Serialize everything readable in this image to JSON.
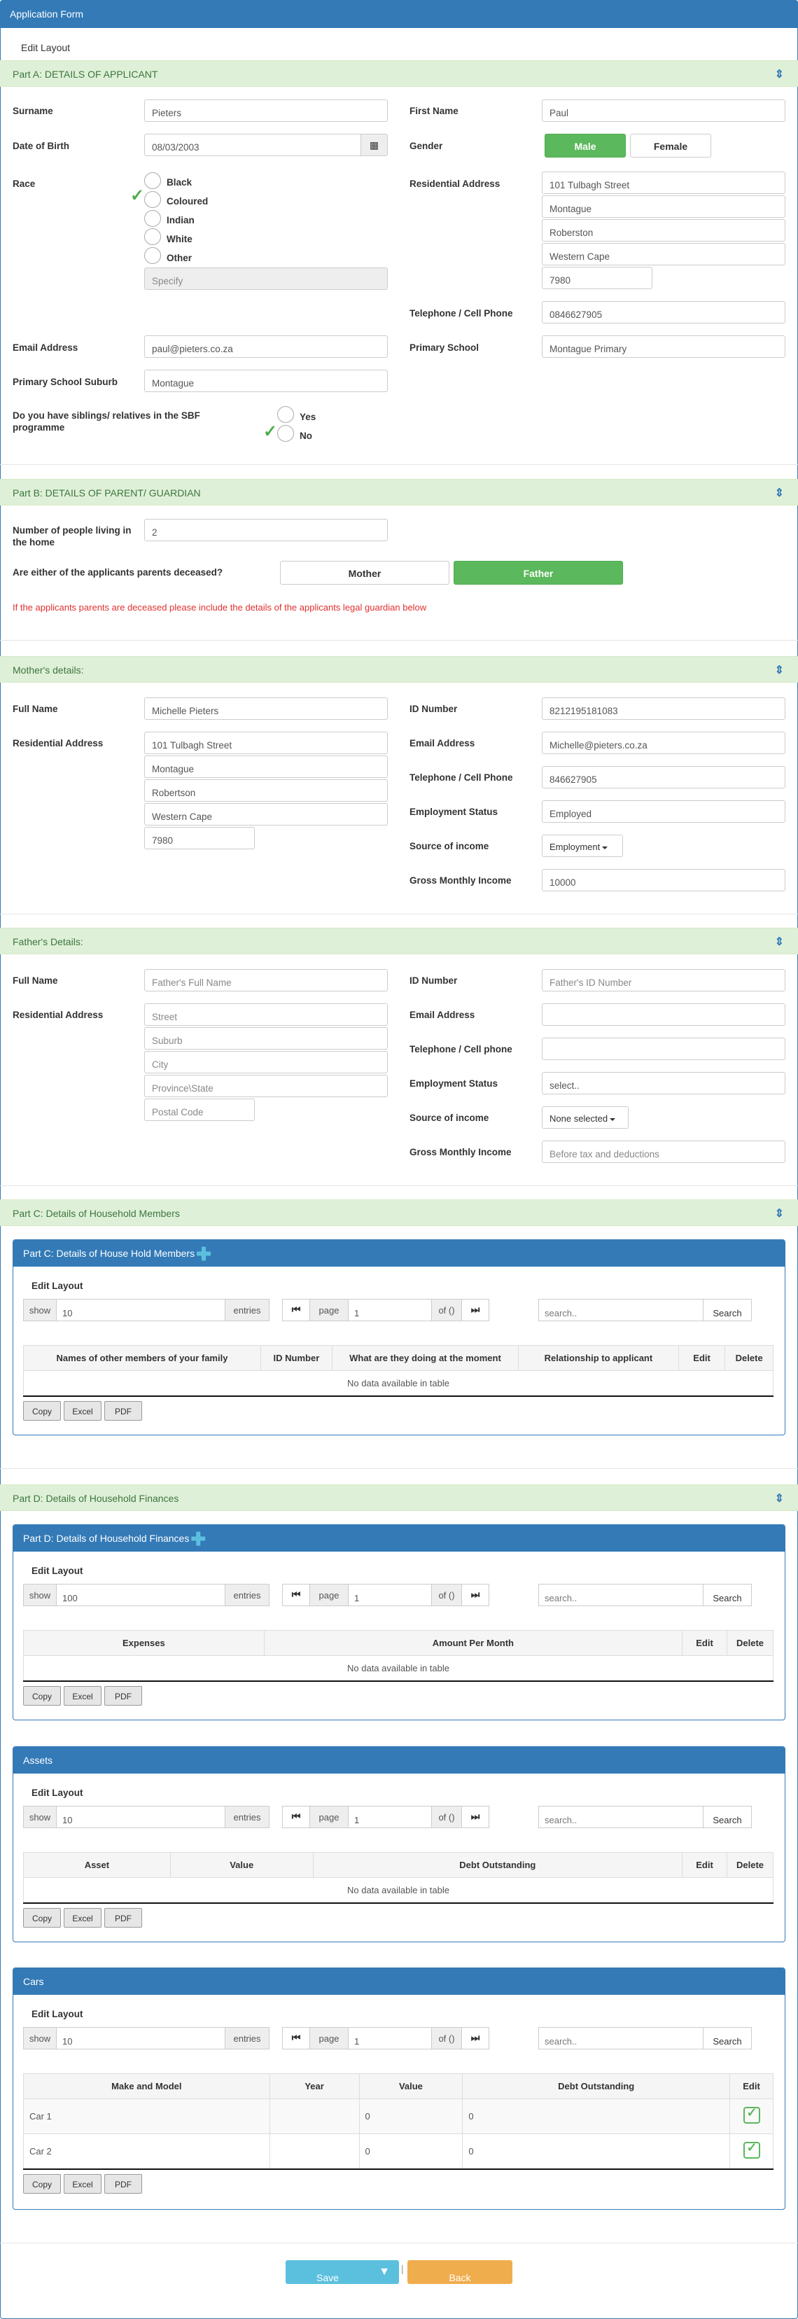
{
  "header": {
    "title": "Application Form"
  },
  "edit_layout": "Edit Layout",
  "partA": {
    "title": "Part A: DETAILS OF APPLICANT",
    "surname_label": "Surname",
    "surname": "Pieters",
    "first_name_label": "First Name",
    "first_name": "Paul",
    "dob_label": "Date of Birth",
    "dob": "08/03/2003",
    "gender_label": "Gender",
    "gender_male": "Male",
    "gender_female": "Female",
    "race_label": "Race",
    "race_options": [
      "Black",
      "Coloured",
      "Indian",
      "White",
      "Other"
    ],
    "race_specify": "Specify",
    "res_label": "Residential Address",
    "res_lines": [
      "101 Tulbagh Street",
      "Montague",
      "Roberston",
      "Western Cape",
      "7980"
    ],
    "tel_label": "Telephone / Cell Phone",
    "tel": "0846627905",
    "email_label": "Email Address",
    "email": "paul@pieters.co.za",
    "school_label": "Primary School",
    "school": "Montague Primary",
    "suburb_label": "Primary School Suburb",
    "suburb": "Montague",
    "siblings_label": "Do you have siblings/ relatives in the SBF programme",
    "sib_yes": "Yes",
    "sib_no": "No"
  },
  "partB": {
    "title": "Part B: DETAILS OF PARENT/ GUARDIAN",
    "people_label": "Number of people living in the home",
    "people": "2",
    "deceased_label": "Are either of the applicants parents deceased?",
    "mother": "Mother",
    "father": "Father",
    "warning": "If the applicants parents are deceased please include the details of the applicants legal guardian below"
  },
  "mother": {
    "title": "Mother's details:",
    "full_name_label": "Full Name",
    "full_name": "Michelle Pieters",
    "id_label": "ID Number",
    "id": "8212195181083",
    "res_label": "Residential Address",
    "res_lines": [
      "101 Tulbagh Street",
      "Montague",
      "Robertson",
      "Western Cape",
      "7980"
    ],
    "email_label": "Email Address",
    "email": "Michelle@pieters.co.za",
    "tel_label": "Telephone / Cell Phone",
    "tel": "846627905",
    "emp_label": "Employment Status",
    "emp": "Employed",
    "src_label": "Source of income",
    "src": "Employment",
    "gross_label": "Gross Monthly Income",
    "gross": "10000"
  },
  "father": {
    "title": "Father's Details:",
    "full_name_label": "Full Name",
    "full_name": "Father's Full Name",
    "id_label": "ID Number",
    "id": "Father's ID Number",
    "res_label": "Residential Address",
    "res_lines": [
      "Street",
      "Suburb",
      "City",
      "Province\\State",
      "Postal Code"
    ],
    "email_label": "Email Address",
    "tel_label": "Telephone / Cell phone",
    "emp_label": "Employment Status",
    "emp": "select..",
    "src_label": "Source of income",
    "src": "None selected",
    "gross_label": "Gross Monthly Income",
    "gross": "Before tax and deductions"
  },
  "partC": {
    "title": "Part C: Details of Household Members",
    "panel_title": "Part C: Details of House Hold Members",
    "show": "show",
    "entries_value": "10",
    "entries": "entries",
    "page": "page",
    "page_value": "1",
    "of": "of ()",
    "search_ph": "search..",
    "search_btn": "Search",
    "columns": [
      "Names of other members of your family",
      "ID Number",
      "What are they doing at the moment",
      "Relationship to applicant",
      "Edit",
      "Delete"
    ],
    "empty": "No data available in table"
  },
  "partD": {
    "title": "Part D: Details of Household Finances",
    "panel_title": "Part D: Details of Household Finances",
    "entries_value": "100",
    "page_value": "1",
    "columns": [
      "Expenses",
      "Amount Per Month",
      "Edit",
      "Delete"
    ],
    "empty": "No data available in table"
  },
  "assets": {
    "panel_title": "Assets",
    "entries_value": "10",
    "page_value": "1",
    "columns": [
      "Asset",
      "Value",
      "Debt Outstanding",
      "Edit",
      "Delete"
    ],
    "empty": "No data available in table"
  },
  "cars": {
    "panel_title": "Cars",
    "entries_value": "10",
    "page_value": "1",
    "columns": [
      "Make and Model",
      "Year",
      "Value",
      "Debt Outstanding",
      "Edit"
    ],
    "rows": [
      {
        "make": "Car 1",
        "year": "",
        "value": "0",
        "debt": "0"
      },
      {
        "make": "Car 2",
        "year": "",
        "value": "0",
        "debt": "0"
      }
    ]
  },
  "export": {
    "copy": "Copy",
    "excel": "Excel",
    "pdf": "PDF"
  },
  "footer": {
    "save": "Save",
    "back": "Back",
    "divider": "|"
  },
  "colors": {
    "primary": "#337ab7",
    "success": "#5cb85c",
    "info": "#5bc0de",
    "warning": "#f0ad4e",
    "section_bg": "#dff0d8"
  },
  "icons": {
    "toggle": "updown-arrow-icon",
    "calendar": "calendar-icon",
    "first_page": "first-page-icon",
    "last_page": "last-page-icon",
    "add": "plus-icon",
    "edit": "edit-check-icon",
    "check": "checkmark-icon"
  }
}
